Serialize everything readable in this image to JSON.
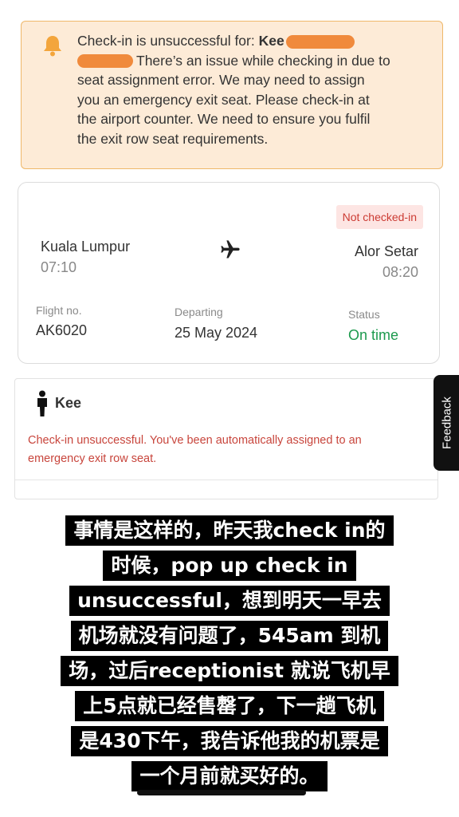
{
  "alert": {
    "icon": "bell-icon",
    "prefix": "Check-in is unsuccessful for: ",
    "name": "Kee",
    "line1_rest": "There’s an issue while checking in due to",
    "line2": "seat assignment error. We may need to assign",
    "line3": "you an emergency exit seat. Please check-in at",
    "line4": "the airport counter. We need to ensure you fulfil",
    "line5": "the exit row seat requirements.",
    "background": "#fdebd7",
    "border": "#efb86a"
  },
  "flight": {
    "status_badge": "Not checked-in",
    "origin_city": "Kuala Lumpur",
    "origin_time": "07:10",
    "destination_city": "Alor Setar",
    "destination_time": "08:20",
    "flight_no_label": "Flight no.",
    "flight_no": "AK6020",
    "departing_label": "Departing",
    "departing": "25 May 2024",
    "status_label": "Status",
    "status": "On time",
    "status_color": "#1d9a4e"
  },
  "passenger": {
    "icon": "person-icon",
    "name": "Kee",
    "error_line1": "Check-in unsuccessful. You've been automatically assigned to an",
    "error_line2": "emergency exit row seat.",
    "error_color": "#c8453c"
  },
  "feedback_tab": {
    "label": "Feedback"
  },
  "caption": {
    "lines": [
      "事情是这样的，昨天我check in的",
      "时候，pop up check in",
      "unsuccessful，想到明天一早去",
      "机场就没有问题了，545am 到机",
      "场，过后receptionist 就说飞机早",
      "上5点就已经售罄了，下一趟飞机",
      "是430下午，我告诉他我的机票是",
      "一个月前就买好的。"
    ]
  }
}
